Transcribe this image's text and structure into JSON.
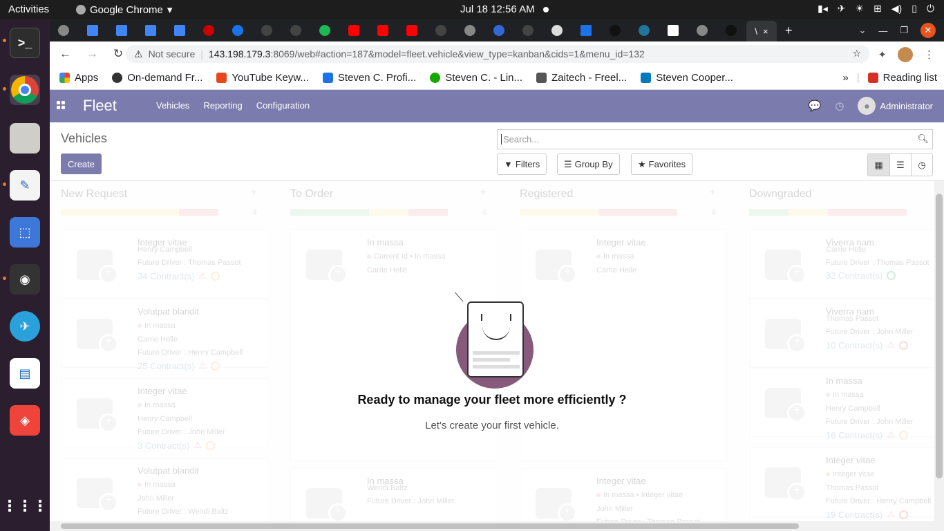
{
  "system": {
    "activities": "Activities",
    "app_name": "Google Chrome",
    "clock": "Jul 18  12:56 AM",
    "tray_icons": [
      "camera-icon",
      "telegram-icon",
      "brightness-icon",
      "network-icon",
      "volume-icon",
      "battery-icon",
      "power-icon"
    ]
  },
  "dock": {
    "items": [
      "terminal",
      "chrome",
      "files",
      "text-editor",
      "screenshot",
      "video",
      "telegram",
      "libreoffice-impress",
      "anydesk",
      "show-apps"
    ]
  },
  "browser": {
    "tab_active_label": "\\",
    "tab_close": "×",
    "new_tab": "+",
    "url_not_secure": "Not secure",
    "url_host": "143.198.179.3",
    "url_path": ":8069/web#action=187&model=fleet.vehicle&view_type=kanban&cids=1&menu_id=132",
    "bookmarks": [
      {
        "label": "Apps",
        "color": "#ea4335"
      },
      {
        "label": "On-demand Fr...",
        "color": "#333333"
      },
      {
        "label": "YouTube Keyw...",
        "color": "#e8471e"
      },
      {
        "label": "Steven C. Profi...",
        "color": "#1a73e8"
      },
      {
        "label": "Steven C. - Lin...",
        "color": "#14a800"
      },
      {
        "label": "Zaitech - Freel...",
        "color": "#555555"
      },
      {
        "label": "Steven Cooper...",
        "color": "#0079bf"
      }
    ],
    "reading_list": "Reading list",
    "more": "»"
  },
  "odoo": {
    "brand": "Fleet",
    "menu": [
      "Vehicles",
      "Reporting",
      "Configuration"
    ],
    "user": "Administrator",
    "breadcrumb": "Vehicles",
    "create_label": "Create",
    "search_placeholder": "Search...",
    "filters_label": "Filters",
    "groupby_label": "Group By",
    "favorites_label": "Favorites"
  },
  "kanban": {
    "columns": [
      {
        "title": "New Request",
        "count": "4",
        "progress": {
          "yellow": 0.75,
          "red": 0.25,
          "green": 0
        }
      },
      {
        "title": "To Order",
        "count": "4",
        "progress": {
          "green": 0.5,
          "yellow": 0.25,
          "red": 0.25
        }
      },
      {
        "title": "Registered",
        "count": "4",
        "progress": {
          "yellow": 0.5,
          "red": 0.5,
          "green": 0
        }
      },
      {
        "title": "Downgraded",
        "count": "",
        "progress": {
          "green": 0.25,
          "yellow": 0.25,
          "red": 0.5
        }
      }
    ],
    "cards": {
      "c0": [
        {
          "title": "Integer vitae",
          "tag": "",
          "driver": "Henry Campbell",
          "future": "Future Driver : Thomas Passot",
          "contracts": "34 Contract(s)"
        },
        {
          "title": "Volutpat blandit",
          "tag": "In massa",
          "driver": "Carrie Helle",
          "future": "Future Driver : Henry Campbell",
          "contracts": "25 Contract(s)"
        },
        {
          "title": "Integer vitae",
          "tag": "In massa",
          "driver": "Henry Campbell",
          "future": "Future Driver : John Miller",
          "contracts": "3 Contract(s)"
        },
        {
          "title": "Volutpat blandit",
          "tag": "In massa",
          "driver": "John Miller",
          "future": "Future Driver : Wendi Baltz",
          "contracts": ""
        }
      ],
      "c1": [
        {
          "title": "In massa",
          "tag": "Current Id • In massa",
          "driver": "Carrie Helle",
          "future": "",
          "contracts": ""
        },
        {
          "title": "In massa",
          "tag": "",
          "driver": "Wendi Baltz",
          "future": "Future Driver : John Miller",
          "contracts": ""
        }
      ],
      "c2": [
        {
          "title": "Integer vitae",
          "tag": "In massa",
          "driver": "Carrie Helle",
          "future": "",
          "contracts": ""
        },
        {
          "title": "Integer vitae",
          "tag": "In massa • Integer vitae",
          "driver": "John Miller",
          "future": "Future Driver : Thomas Passot",
          "contracts": ""
        }
      ],
      "c3": [
        {
          "title": "Viverra nam",
          "tag": "",
          "driver": "Carrie Helle",
          "future": "Future Driver : Thomas Passot",
          "contracts": "32 Contract(s)"
        },
        {
          "title": "Viverra nam",
          "tag": "",
          "driver": "Thomas Passot",
          "future": "Future Driver : John Miller",
          "contracts": "10 Contract(s)"
        },
        {
          "title": "In massa",
          "tag": "In massa",
          "driver": "Henry Campbell",
          "future": "Future Driver : John Miller",
          "contracts": "16 Contract(s)"
        },
        {
          "title": "Integer vitae",
          "tag": "Integer vitae",
          "driver": "Thomas Passot",
          "future": "Future Driver : Henry Campbell",
          "contracts": "19 Contract(s)"
        }
      ]
    }
  },
  "help": {
    "title": "Ready to manage your fleet more efficiently ?",
    "subtitle": "Let's create your first vehicle."
  },
  "colors": {
    "accent": "#7c7bad",
    "green": "#a4d4a8",
    "yellow": "#f6e39b",
    "red": "#eaa3ab"
  }
}
